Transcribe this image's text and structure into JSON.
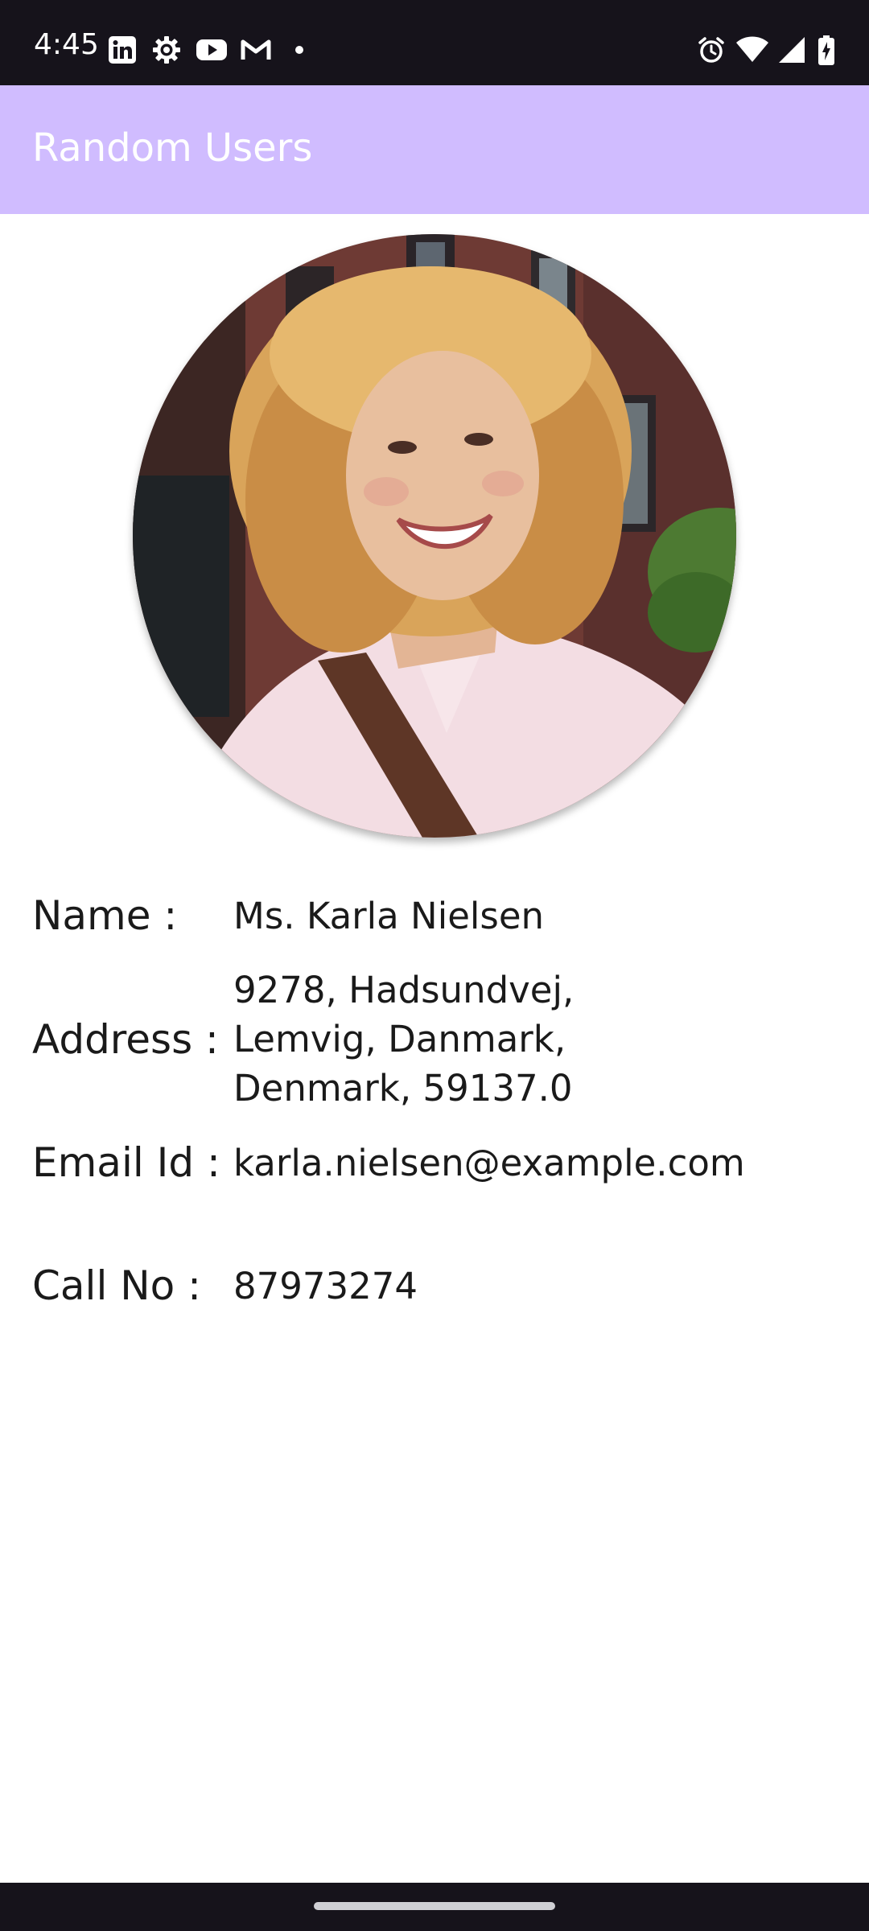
{
  "status_bar": {
    "time": "4:45",
    "left_icons": [
      "linkedin-icon",
      "settings-gear-icon",
      "youtube-icon",
      "gmail-icon",
      "notification-dot-icon"
    ],
    "right_icons": [
      "alarm-icon",
      "wifi-icon",
      "cellular-signal-icon",
      "battery-charging-icon"
    ]
  },
  "app_bar": {
    "title": "Random Users",
    "color": "#d0bcff"
  },
  "profile": {
    "photo": "user-photo-woman",
    "name_label": "Name :",
    "name_value": "Ms. Karla Nielsen",
    "address_label": "Address :",
    "address_lines": [
      "9278, Hadsundvej,",
      "Lemvig, Danmark,",
      "Denmark, 59137.0"
    ],
    "email_label": "Email Id :",
    "email_value": "karla.nielsen@example.com",
    "call_label": "Call No :",
    "call_value": "87973274"
  },
  "colors": {
    "status_bar_bg": "#16131b",
    "text": "#1a1a1a",
    "title_text": "#ffffff"
  }
}
